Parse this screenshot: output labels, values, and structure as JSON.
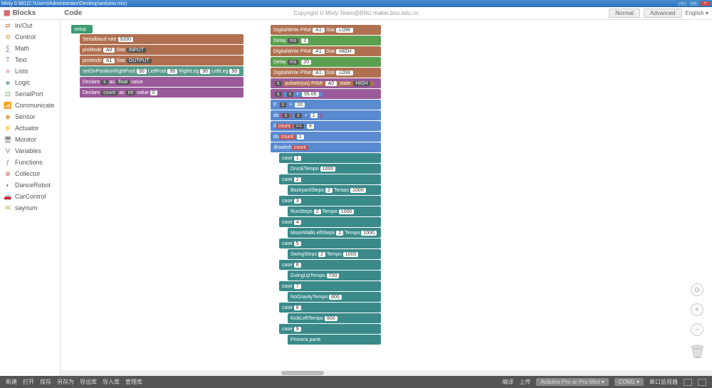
{
  "titlebar": "Mixly 0.991(C:\\Users\\Administrator\\Desktop\\arduino.mix)",
  "header": {
    "blocks": "Blocks",
    "code": "Code",
    "copyright": "Copyright © Mixly Team@BNU maker.bnu.edu.cn",
    "normal": "Normal",
    "advanced": "Advanced",
    "lang": "English"
  },
  "sidebar": [
    {
      "icon": "⇄",
      "label": "In/Out",
      "color": "#d08a4a"
    },
    {
      "icon": "⚙",
      "label": "Control",
      "color": "#d0a050"
    },
    {
      "icon": "∑",
      "label": "Math",
      "color": "#5a8ad0"
    },
    {
      "icon": "T",
      "label": "Text",
      "color": "#5aa050"
    },
    {
      "icon": "≡",
      "label": "Lists",
      "color": "#d05a8a"
    },
    {
      "icon": "◈",
      "label": "Logic",
      "color": "#5a9a8a"
    },
    {
      "icon": "⊡",
      "label": "SerialPort",
      "color": "#5aa050"
    },
    {
      "icon": "📶",
      "label": "Communicate",
      "color": "#5a8ad0"
    },
    {
      "icon": "◉",
      "label": "Sensor",
      "color": "#d0a050"
    },
    {
      "icon": "⚡",
      "label": "Actuator",
      "color": "#d08a4a"
    },
    {
      "icon": "🖥",
      "label": "Monitor",
      "color": "#888"
    },
    {
      "icon": "V",
      "label": "Variables",
      "color": "#9a5a9a"
    },
    {
      "icon": "ƒ",
      "label": "Functions",
      "color": "#5a9a8a"
    },
    {
      "icon": "⊕",
      "label": "Collector",
      "color": "#d05a5a"
    },
    {
      "icon": "◐",
      "label": "DanceRobot",
      "color": "#5a8ad0"
    },
    {
      "icon": "🚗",
      "label": "CarControl",
      "color": "#5aa050"
    },
    {
      "icon": "✉",
      "label": "saynum",
      "color": "#d0a050"
    }
  ],
  "blocks1": {
    "setup": "setup",
    "serial": "Serial",
    "baud": "baud rate",
    "baud_v": "9200",
    "pinmode": "pinMode",
    "a0": "A0",
    "stat": "Stat",
    "input": "INPUT",
    "a1": "A1",
    "output": "OUTPUT",
    "setpos": "setOnPosition",
    "rightfoot": "RightFoot",
    "v90": "90",
    "leftfoot": "LeftFoot",
    "rightleg": "RightLeg",
    "leftleg": "LeftLeg",
    "declare": "Declare",
    "s": "s",
    "as": "as",
    "float": "float",
    "value": "value",
    "count": "count",
    "int": "int",
    "v0": "0"
  },
  "blocks2": {
    "dwrite": "DigitalWrite PIN#",
    "a1": "A1",
    "stat": "Stat",
    "low": "LOW",
    "high": "HIGH",
    "delay": "Delay",
    "ms": "ms",
    "v2": "2",
    "v20": "20",
    "pulsein": "pulseIn(us) PIN#",
    "a0": "A0",
    "state": "state",
    "s": "s",
    "mul": "×",
    "v5500": "55.00",
    "v10": "10",
    "v1": "1",
    "add": "+",
    "if": "if",
    "count": "count",
    "eq": "==",
    "v9": "9",
    "do": "do",
    "switch": "switch",
    "case": "case",
    "c1": "1",
    "c2": "2",
    "c3": "3",
    "c4": "4",
    "c5": "5",
    "c6": "6",
    "c7": "7",
    "c8": "8",
    "c9": "9",
    "drunk": "Drunk",
    "tempo": "Tempo",
    "v1000": "1000",
    "backyard": "Backyard",
    "steps": "Steps",
    "sv2": "2",
    "run": "Run",
    "moonwalk": "MoonWalkLeft",
    "swing": "Swing",
    "goingup": "GoingUp",
    "v700": "700",
    "nogravity": "NoGravity",
    "v800": "800",
    "kickleft": "KickLeft",
    "v900": "900",
    "primera": "Primera parte"
  },
  "footer": {
    "new": "新建",
    "open": "打开",
    "save": "保存",
    "saveas": "另存为",
    "export": "导出库",
    "import": "导入库",
    "manage": "管理库",
    "compile": "编译",
    "upload": "上传",
    "board": "Arduino Pro or Pro Mini",
    "port": "COM1",
    "monitor": "串口监视器"
  }
}
